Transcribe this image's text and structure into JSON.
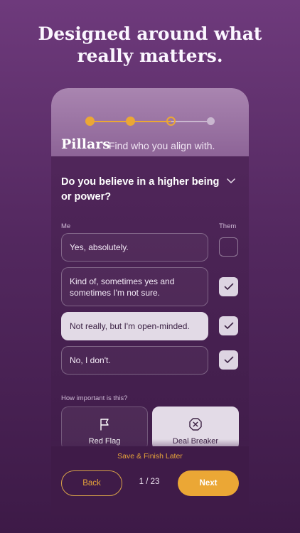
{
  "headline": {
    "line1": "Designed around what",
    "line2": "really matters."
  },
  "header": {
    "title": "Pillars",
    "subtitle": "Find who you align with.",
    "steps": [
      {
        "state": "complete"
      },
      {
        "state": "complete"
      },
      {
        "state": "current"
      },
      {
        "state": "upcoming"
      }
    ]
  },
  "question": {
    "text": "Do you believe in a higher being or power?",
    "icon": "chevron-down-icon"
  },
  "columns": {
    "me": "Me",
    "them": "Them"
  },
  "options": [
    {
      "label": "Yes, absolutely.",
      "selected": false,
      "them_checked": false
    },
    {
      "label": "Kind of, sometimes yes and sometimes I'm not sure.",
      "selected": false,
      "them_checked": true
    },
    {
      "label": "Not really, but I'm open-minded.",
      "selected": true,
      "them_checked": true
    },
    {
      "label": "No, I don't.",
      "selected": false,
      "them_checked": true
    }
  ],
  "importance": {
    "label": "How important is this?",
    "red_flag": {
      "label": "Red Flag",
      "icon": "flag-icon",
      "active": false
    },
    "deal_breaker": {
      "label": "Deal Breaker",
      "icon": "x-octagon-icon",
      "active": true
    }
  },
  "footer": {
    "save_later": "Save & Finish Later",
    "back": "Back",
    "page": "1 / 23",
    "next": "Next"
  },
  "colors": {
    "accent": "#eba735",
    "step_upcoming": "#c9b7cf",
    "check": "#3c2244"
  }
}
